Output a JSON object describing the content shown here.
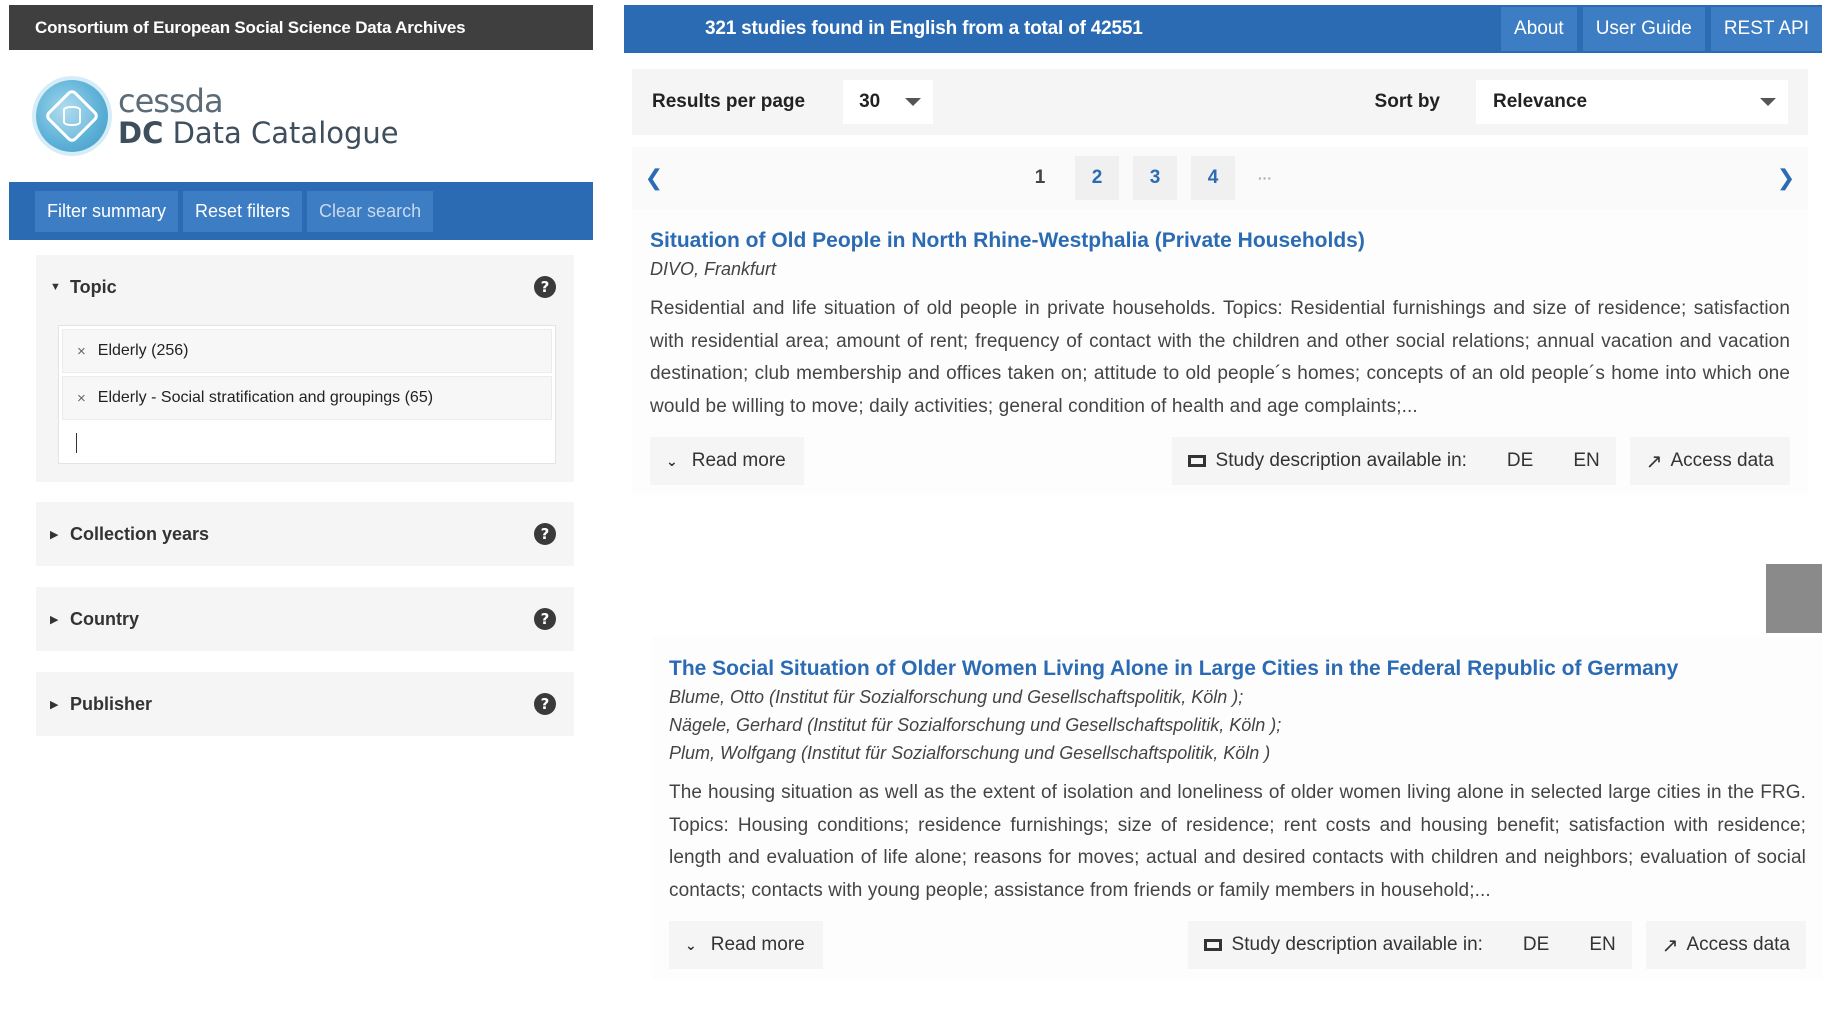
{
  "sidebar": {
    "org_name": "Consortium of European Social Science Data Archives",
    "logo": {
      "line1": "cessda",
      "line2_bold": "DC",
      "line2_rest": " Data Catalogue"
    },
    "buttons": {
      "filter_summary": "Filter summary",
      "reset_filters": "Reset filters",
      "clear_search": "Clear search"
    },
    "facets": [
      {
        "label": "Topic",
        "expanded": true,
        "chips": [
          "Elderly (256)",
          "Elderly - Social stratification and groupings (65)"
        ]
      },
      {
        "label": "Collection years",
        "expanded": false
      },
      {
        "label": "Country",
        "expanded": false
      },
      {
        "label": "Publisher",
        "expanded": false
      }
    ],
    "help_glyph": "?",
    "chip_remove_glyph": "×"
  },
  "header": {
    "results_text": "321 studies found in English from a total of 42551",
    "nav": [
      "About",
      "User Guide",
      "REST API"
    ]
  },
  "controls": {
    "per_page_label": "Results per page",
    "per_page_value": "30",
    "sort_label": "Sort by",
    "sort_value": "Relevance"
  },
  "pagination": {
    "current": "1",
    "pages": [
      "2",
      "3",
      "4"
    ],
    "ellipsis": "···"
  },
  "results": [
    {
      "title": "Situation of Old People in North Rhine-Westphalia (Private Households)",
      "creators": [
        "DIVO, Frankfurt"
      ],
      "description": "Residential and life situation of old people in private households. Topics: Residential furnishings and size of residence; satisfaction with residential area; amount of rent; frequency of contact with the children and other social relations; annual vacation and vacation destination; club membership and offices taken on; attitude to old people´s homes; concepts of an old people´s home into which one would be willing to move; daily activities; general condition of health and age complaints;...",
      "read_more": "Read more",
      "langs_label": "Study description available in:",
      "langs": [
        "DE",
        "EN"
      ],
      "access": "Access data"
    },
    {
      "title": "The Social Situation of Older Women Living Alone in Large Cities in the Federal Republic of Germany",
      "creators": [
        "Blume, Otto (Institut für Sozialforschung und Gesellschaftspolitik, Köln );",
        "Nägele, Gerhard (Institut für Sozialforschung und Gesellschaftspolitik, Köln );",
        "Plum, Wolfgang (Institut für Sozialforschung und Gesellschaftspolitik, Köln )"
      ],
      "description": "The housing situation as well as the extent of isolation and loneliness of older women living alone in selected large cities in the FRG. Topics: Housing conditions; residence furnishings; size of residence; rent costs and housing benefit; satisfaction with residence; length and evaluation of life alone; reasons for moves; actual and desired contacts with children and neighbors; evaluation of social contacts; contacts with young people; assistance from friends or family members in household;...",
      "read_more": "Read more",
      "langs_label": "Study description available in:",
      "langs": [
        "DE",
        "EN"
      ],
      "access": "Access data"
    }
  ],
  "colors": {
    "brand_blue": "#2b6bb3",
    "button_blue": "#3d7dc4",
    "dark_bar": "#403f3f",
    "panel_grey": "#f5f5f5"
  }
}
